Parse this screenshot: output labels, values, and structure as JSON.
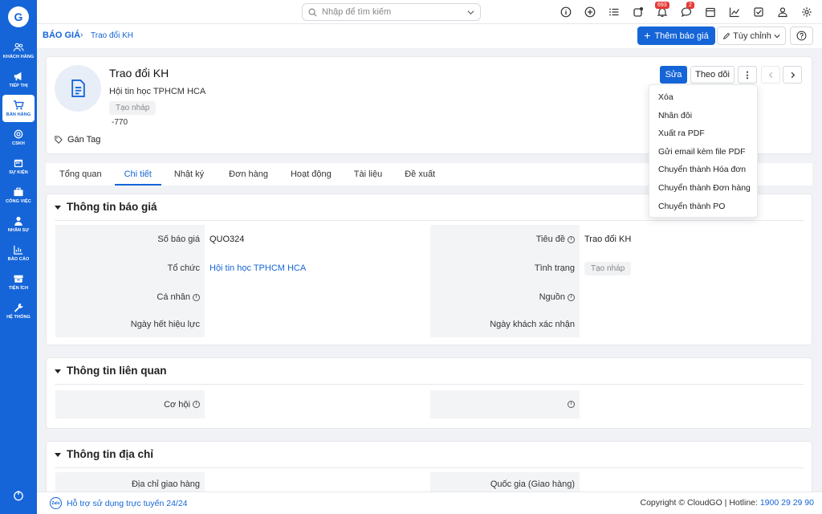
{
  "sidebar": {
    "logo": "G",
    "items": [
      {
        "label": "KHÁCH HÀNG",
        "icon": "users-icon"
      },
      {
        "label": "TIẾP THỊ",
        "icon": "megaphone-icon"
      },
      {
        "label": "BÁN HÀNG",
        "icon": "cart-icon"
      },
      {
        "label": "CSKH",
        "icon": "lifebuoy-icon"
      },
      {
        "label": "SỰ KIỆN",
        "icon": "calendar-icon"
      },
      {
        "label": "CÔNG VIỆC",
        "icon": "briefcase-icon"
      },
      {
        "label": "NHÂN SỰ",
        "icon": "person-icon"
      },
      {
        "label": "BÁO CÁO",
        "icon": "chart-icon"
      },
      {
        "label": "TIỆN ÍCH",
        "icon": "box-icon"
      },
      {
        "label": "HỆ THỐNG",
        "icon": "wrench-icon"
      }
    ],
    "active_index": 2
  },
  "topbar": {
    "search_placeholder": "Nhập để tìm kiếm",
    "notification_count": "693",
    "chat_count": "2"
  },
  "breadcrumb": {
    "module": "BÁO GIÁ",
    "separator": "›",
    "current": "Trao đổi KH"
  },
  "actions": {
    "add_label": "Thêm báo giá",
    "custom_label": "Tùy chỉnh"
  },
  "record": {
    "title": "Trao đổi KH",
    "organization": "Hội tin học TPHCM HCA",
    "status": "Tạo nháp",
    "amount": "-770",
    "tag_label": "Gán Tag",
    "edit_label": "Sửa",
    "follow_label": "Theo dõi"
  },
  "tabs": [
    "Tổng quan",
    "Chi tiết",
    "Nhật ký",
    "Đơn hàng",
    "Hoạt động",
    "Tài liệu",
    "Đề xuất"
  ],
  "active_tab": 1,
  "dropdown": {
    "items": [
      "Xóa",
      "Nhân đôi",
      "Xuất ra PDF",
      "Gửi email kèm file PDF",
      "Chuyển thành Hóa đơn",
      "Chuyển thành Đơn hàng",
      "Chuyển thành PO"
    ]
  },
  "sections": {
    "quote_info": {
      "title": "Thông tin báo giá",
      "so_bao_gia_label": "Số báo giá",
      "so_bao_gia_value": "QUO324",
      "tieu_de_label": "Tiêu đề",
      "tieu_de_value": "Trao đổi KH",
      "to_chuc_label": "Tổ chức",
      "to_chuc_value": "Hội tin học TPHCM HCA",
      "tinh_trang_label": "Tình trạng",
      "tinh_trang_value": "Tạo nháp",
      "ca_nhan_label": "Cá nhân",
      "nguon_label": "Nguồn",
      "ngay_het_hieu_luc_label": "Ngày hết hiệu lực",
      "ngay_khach_xac_nhan_label": "Ngày khách xác nhận"
    },
    "related_info": {
      "title": "Thông tin liên quan",
      "co_hoi_label": "Cơ hội"
    },
    "address_info": {
      "title": "Thông tin địa chỉ",
      "dia_chi_giao_hang_label": "Địa chỉ giao hàng",
      "quoc_gia_label": "Quốc gia (Giao hàng)"
    }
  },
  "footer": {
    "zalo": "Zalo",
    "support": "Hỗ trợ sử dụng trực tuyến 24/24",
    "copyright": "Copyright © CloudGO | Hotline: ",
    "hotline": "1900 29 29 90"
  },
  "colors": {
    "primary": "#1565d8",
    "badge": "#e53935"
  }
}
